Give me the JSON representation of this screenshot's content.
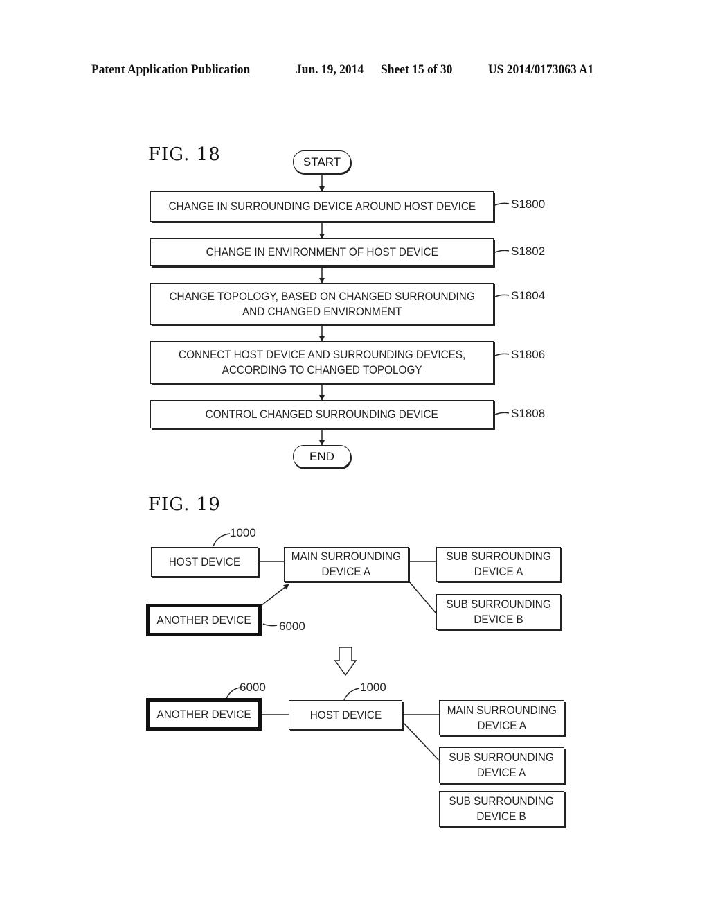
{
  "header": {
    "publication": "Patent Application Publication",
    "date": "Jun. 19, 2014",
    "sheet": "Sheet 15 of 30",
    "number": "US 2014/0173063 A1"
  },
  "fig18": {
    "title": "FIG.  18",
    "start": "START",
    "end": "END",
    "steps": [
      {
        "text": "CHANGE IN SURROUNDING DEVICE AROUND HOST DEVICE",
        "ref": "S1800"
      },
      {
        "text": "CHANGE IN ENVIRONMENT OF HOST DEVICE",
        "ref": "S1802"
      },
      {
        "text": "CHANGE TOPOLOGY, BASED ON CHANGED SURROUNDING\nAND CHANGED ENVIRONMENT",
        "ref": "S1804"
      },
      {
        "text": "CONNECT HOST DEVICE AND SURROUNDING DEVICES,\nACCORDING TO CHANGED TOPOLOGY",
        "ref": "S1806"
      },
      {
        "text": "CONTROL CHANGED SURROUNDING DEVICE",
        "ref": "S1808"
      }
    ]
  },
  "fig19": {
    "title": "FIG.  19",
    "before": {
      "host": "HOST DEVICE",
      "host_ref": "1000",
      "main": "MAIN SURROUNDING\nDEVICE  A",
      "sub_a": "SUB SURROUNDING\nDEVICE  A",
      "sub_b": "SUB SURROUNDING\nDEVICE  B",
      "another": "ANOTHER DEVICE",
      "another_ref": "6000"
    },
    "after": {
      "another": "ANOTHER DEVICE",
      "another_ref": "6000",
      "host": "HOST DEVICE",
      "host_ref": "1000",
      "main": "MAIN SURROUNDING\nDEVICE  A",
      "sub_a": "SUB SURROUNDING\nDEVICE  A",
      "sub_b": "SUB SURROUNDING\nDEVICE  B"
    }
  }
}
